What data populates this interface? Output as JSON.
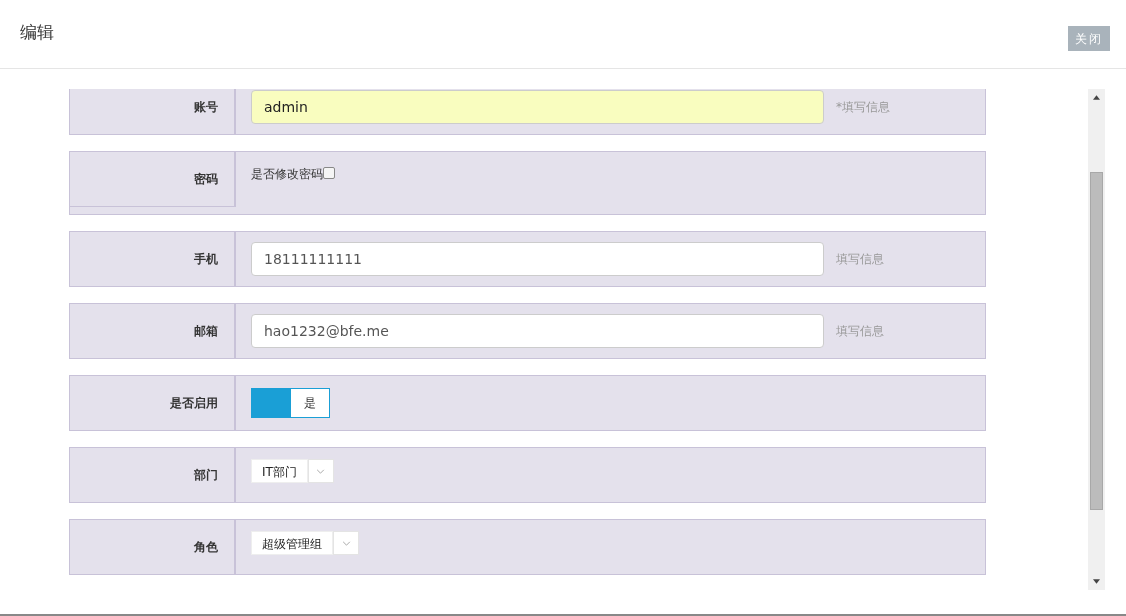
{
  "dialog": {
    "title": "编辑",
    "close_button": "关闭"
  },
  "fields": [
    {
      "kind": "text",
      "label": "账号",
      "value": "admin",
      "autofilled": true,
      "hint": "*填写信息"
    },
    {
      "kind": "checkbox",
      "label": "密码",
      "text": "是否修改密码",
      "checked": false
    },
    {
      "kind": "text",
      "label": "手机",
      "value": "18111111111",
      "autofilled": false,
      "hint": "填写信息"
    },
    {
      "kind": "text",
      "label": "邮箱",
      "value": "hao1232@bfe.me",
      "autofilled": false,
      "hint": "填写信息"
    },
    {
      "kind": "toggle",
      "label": "是否启用",
      "text": "是",
      "on": true
    },
    {
      "kind": "select",
      "label": "部门",
      "value": "IT部门"
    },
    {
      "kind": "select",
      "label": "角色",
      "value": "超级管理组"
    }
  ]
}
